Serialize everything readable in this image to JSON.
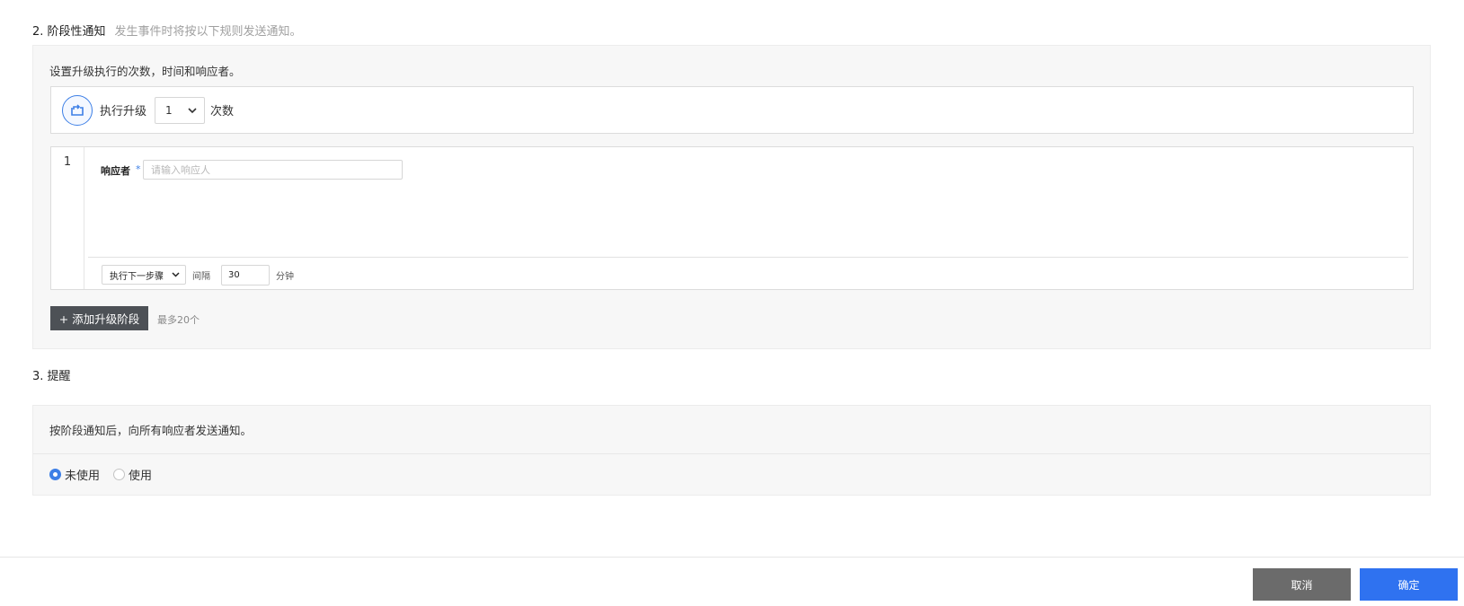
{
  "stage_section": {
    "title": "2. 阶段性通知",
    "description": "发生事件时将按以下规则发送通知。",
    "panel_desc": "设置升级执行的次数，时间和响应者。",
    "exec_label": "执行升级",
    "count_value": "1",
    "count_unit": "次数",
    "stage_number": "1",
    "responder_label": "响应者",
    "required_mark": "*",
    "responder_placeholder": "请输入响应人",
    "next_step_value": "执行下一步骤",
    "interval_label": "间隔",
    "interval_value": "30",
    "minute_label": "分钟",
    "add_stage_label": "+ 添加升级阶段",
    "add_limit": "最多20个"
  },
  "remind_section": {
    "title": "3. 提醒",
    "description": "按阶段通知后，向所有响应者发送通知。",
    "options": [
      {
        "label": "未使用",
        "checked": true
      },
      {
        "label": "使用",
        "checked": false
      }
    ]
  },
  "footer": {
    "cancel_label": "取消",
    "ok_label": "确定"
  },
  "colors": {
    "accent": "#2f72f0",
    "icon_blue": "#3d7fe6",
    "dark_button": "#4d5156",
    "cancel_button": "#6b6b6b"
  },
  "icons": {
    "exec": "escalate-loop-icon",
    "dropdown": "chevron-down-icon"
  }
}
